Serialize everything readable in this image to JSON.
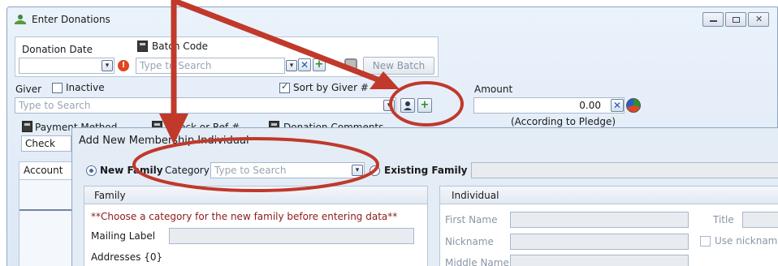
{
  "window": {
    "title": "Enter Donations",
    "controls": {
      "minimize": "—",
      "maximize": "▢",
      "close": "✕"
    }
  },
  "donation_date": {
    "label": "Donation Date",
    "value": ""
  },
  "batch_code": {
    "label": "Batch Code",
    "placeholder": "Type to Search",
    "new_batch_label": "New Batch"
  },
  "giver": {
    "label": "Giver",
    "inactive_label": "Inactive",
    "sort_label": "Sort by Giver #",
    "placeholder": "Type to Search"
  },
  "amount": {
    "label": "Amount",
    "value": "0.00",
    "note": "(According to Pledge)"
  },
  "payment": {
    "method_label": "Payment Method",
    "method_value": "Check",
    "check_ref_label": "Check or Ref #",
    "comments_label": "Donation Comments"
  },
  "account_label": "Account",
  "dialog": {
    "title": "Add New Membership Individual",
    "new_family_label": "New Family",
    "category_label": "Category",
    "category_placeholder": "Type to Search",
    "existing_family_label": "Existing Family",
    "family_section": {
      "title": "Family",
      "warning": "**Choose a category for the new family before entering data**",
      "mailing_label": "Mailing Label",
      "addresses_label": "Addresses {0}"
    },
    "individual_section": {
      "title": "Individual",
      "first_name": "First Name",
      "title_label": "Title",
      "nickname": "Nickname",
      "use_nickname": "Use nickname",
      "middle_name": "Middle Name"
    }
  },
  "colors": {
    "annotation": "#c0392b",
    "window_bg": "#dde8f5",
    "warning_text": "#8b1a1a"
  }
}
